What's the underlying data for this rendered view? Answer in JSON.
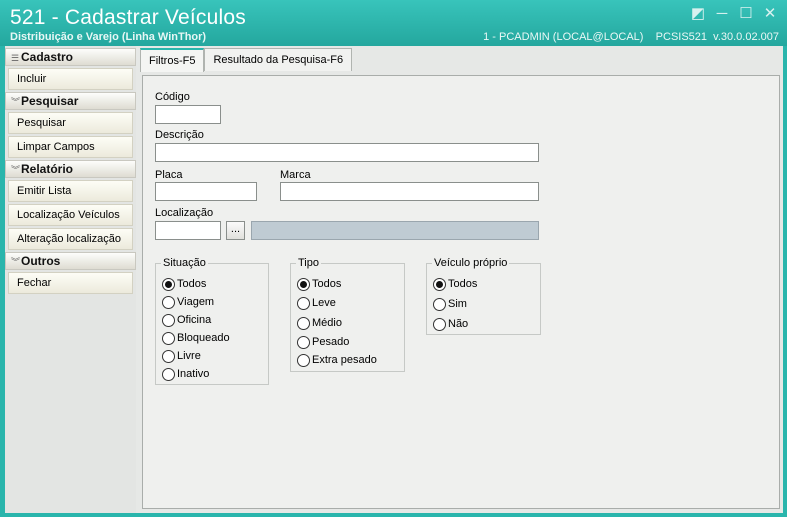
{
  "window": {
    "title": "521 - Cadastrar Veículos",
    "subtitle": "Distribuição e Varejo (Linha WinThor)",
    "status": "1 - PCADMIN (LOCAL@LOCAL)    PCSIS521  v.30.0.02.007",
    "controls": {
      "restore": "◩",
      "minimize": "─",
      "maximize": "☐",
      "close": "✕"
    }
  },
  "sidebar": {
    "groups": [
      {
        "title": "Cadastro",
        "items": [
          "Incluir"
        ]
      },
      {
        "title": "Pesquisar",
        "items": [
          "Pesquisar",
          "Limpar Campos"
        ]
      },
      {
        "title": "Relatório",
        "items": [
          "Emitir Lista",
          "Localização Veículos",
          "Alteração localização"
        ]
      },
      {
        "title": "Outros",
        "items": [
          "Fechar"
        ]
      }
    ]
  },
  "tabs": {
    "filtros": "Filtros-F5",
    "resultado": "Resultado da Pesquisa-F6"
  },
  "form": {
    "codigo_label": "Código",
    "codigo_value": "",
    "descricao_label": "Descrição",
    "descricao_value": "",
    "placa_label": "Placa",
    "placa_value": "",
    "marca_label": "Marca",
    "marca_value": "",
    "localizacao_label": "Localização",
    "localizacao_value": "",
    "ellipsis": "...",
    "localizacao_desc": ""
  },
  "situacao": {
    "title": "Situação",
    "options": [
      "Todos",
      "Viagem",
      "Oficina",
      "Bloqueado",
      "Livre",
      "Inativo"
    ],
    "selected": 0
  },
  "tipo": {
    "title": "Tipo",
    "options": [
      "Todos",
      "Leve",
      "Médio",
      "Pesado",
      "Extra pesado"
    ],
    "selected": 0
  },
  "proprio": {
    "title": "Veículo próprio",
    "options": [
      "Todos",
      "Sim",
      "Não"
    ],
    "selected": 0
  }
}
